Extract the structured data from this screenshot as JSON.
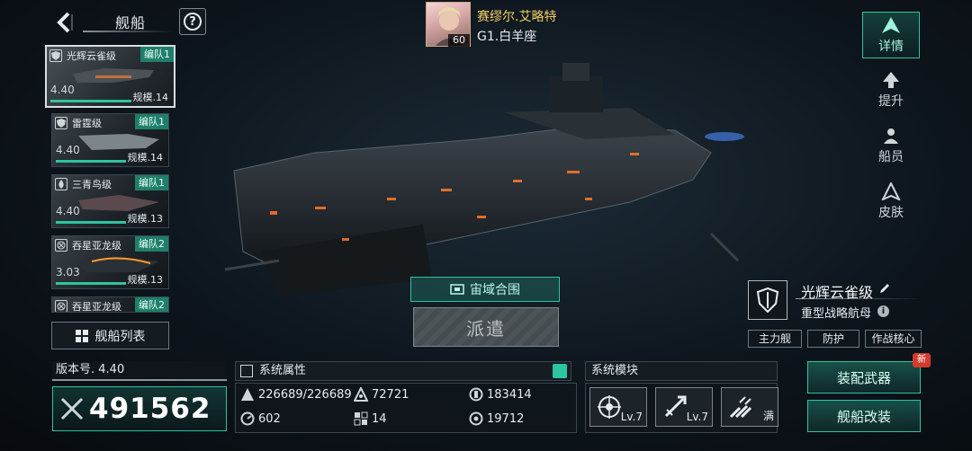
{
  "header": {
    "title": "舰船"
  },
  "commander": {
    "name": "赛缪尔.艾略特",
    "rank": "G1.白羊座",
    "level": "60"
  },
  "ship_cards": [
    {
      "name": "光辉云雀级",
      "fleet": "编队1",
      "level": "4.40",
      "scale": "规模.14",
      "selected": true
    },
    {
      "name": "雷霆级",
      "fleet": "编队1",
      "level": "4.40",
      "scale": "规模.14"
    },
    {
      "name": "三青鸟级",
      "fleet": "编队1",
      "level": "4.40",
      "scale": "规模.13"
    },
    {
      "name": "吞星亚龙级",
      "fleet": "编队2",
      "level": "3.03",
      "scale": "规模.13"
    },
    {
      "name": "吞星亚龙级",
      "fleet": "编队2"
    }
  ],
  "ship_list_button": "舰船列表",
  "tabs": [
    {
      "label": "详情",
      "active": true
    },
    {
      "label": "提升"
    },
    {
      "label": "船员"
    },
    {
      "label": "皮肤"
    }
  ],
  "union_button": "宙域合围",
  "dispatch_button": "派遣",
  "ship_info": {
    "name": "光辉云雀级",
    "type": "重型战略航母",
    "tags": [
      "主力舰",
      "防护",
      "作战核心"
    ]
  },
  "version": "版本号. 4.40",
  "power": "491562",
  "attributes": {
    "title": "系统属性",
    "items": [
      {
        "icon": "hp-icon",
        "value": "226689/226689"
      },
      {
        "icon": "armor-icon",
        "value": "72721"
      },
      {
        "icon": "shield-stat-icon",
        "value": "183414"
      },
      {
        "icon": "speed-icon",
        "value": "602"
      },
      {
        "icon": "grid-stat-icon",
        "value": "14"
      },
      {
        "icon": "target-stat-icon",
        "value": "19712"
      }
    ]
  },
  "modules": {
    "title": "系统模块",
    "items": [
      {
        "icon": "radar-module-icon",
        "level": "Lv.7"
      },
      {
        "icon": "missile-module-icon",
        "level": "Lv.7"
      },
      {
        "icon": "rocket-module-icon",
        "level": "满"
      }
    ]
  },
  "actions": {
    "equip_weapons": "装配武器",
    "refit": "舰船改装",
    "new_badge": "新"
  },
  "colors": {
    "accent": "#2ec4a1",
    "gold": "#f3cf63",
    "badge": "#d23b2e"
  }
}
